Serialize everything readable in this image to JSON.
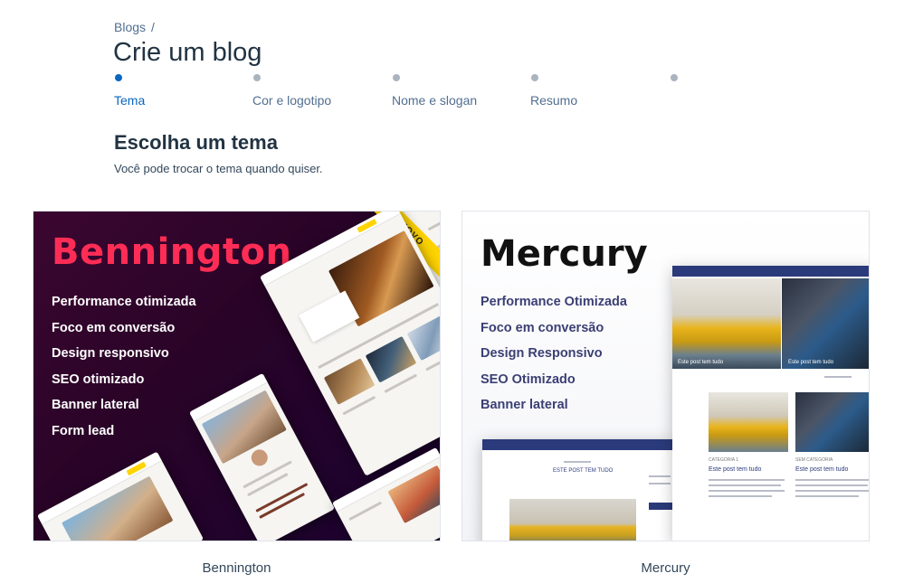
{
  "breadcrumb": {
    "parent": "Blogs",
    "separator": "/"
  },
  "page_title": "Crie um blog",
  "stepper": {
    "steps": [
      {
        "label": "Tema",
        "active": true
      },
      {
        "label": "Cor e logotipo",
        "active": false
      },
      {
        "label": "Nome e slogan",
        "active": false
      },
      {
        "label": "Resumo",
        "active": false
      },
      {
        "label": "",
        "active": false
      }
    ]
  },
  "section": {
    "title": "Escolha um tema",
    "subtitle": "Você pode trocar o tema quando quiser."
  },
  "themes": [
    {
      "name": "Bennington",
      "preview_title": "Bennington",
      "badge": "NOVO",
      "features": [
        "Performance otimizada",
        "Foco em conversão",
        "Design responsivo",
        "SEO otimizado",
        "Banner lateral",
        "Form lead"
      ],
      "accent": "#ff2d55"
    },
    {
      "name": "Mercury",
      "preview_title": "Mercury",
      "features": [
        "Performance Otimizada",
        "Foco em conversão",
        "Design Responsivo",
        "SEO Otimizado",
        "Banner lateral"
      ],
      "mock_texts": {
        "hero_left": "Este post tem tudo",
        "hero_right": "Este post tem tudo",
        "category_1": "CATEGORIA 1",
        "category_2": "SEM CATEGORIA",
        "post_title_1": "Este post tem tudo",
        "post_title_2": "Este post tem tudo",
        "small_post_title": "ESTE POST TEM TUDO"
      },
      "accent": "#2b3a7a"
    }
  ],
  "colors": {
    "primary": "#0a66c2",
    "text_dark": "#213343",
    "muted": "#516f90"
  }
}
